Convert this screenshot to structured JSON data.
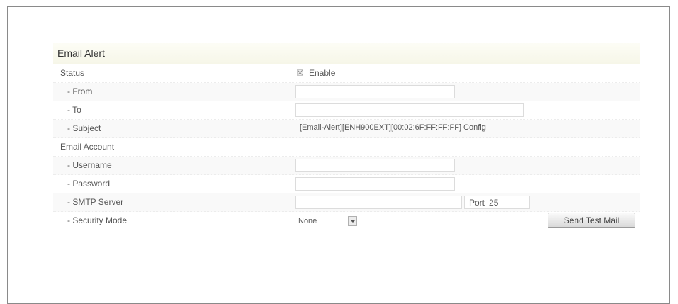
{
  "panel": {
    "title": "Email Alert"
  },
  "status": {
    "label": "Status",
    "enable_label": "Enable",
    "enabled": true
  },
  "from": {
    "label": "- From",
    "value": ""
  },
  "to": {
    "label": "- To",
    "value": ""
  },
  "subject": {
    "label": "- Subject",
    "value": "[Email-Alert][ENH900EXT][00:02:6F:FF:FF:FF] Config"
  },
  "account": {
    "label": "Email Account"
  },
  "username": {
    "label": "- Username",
    "value": ""
  },
  "password": {
    "label": "- Password",
    "value": ""
  },
  "smtp": {
    "label": "- SMTP Server",
    "value": "",
    "port_label": "Port",
    "port_value": "25"
  },
  "security": {
    "label": "- Security Mode",
    "selected": "None",
    "test_button": "Send Test Mail"
  }
}
